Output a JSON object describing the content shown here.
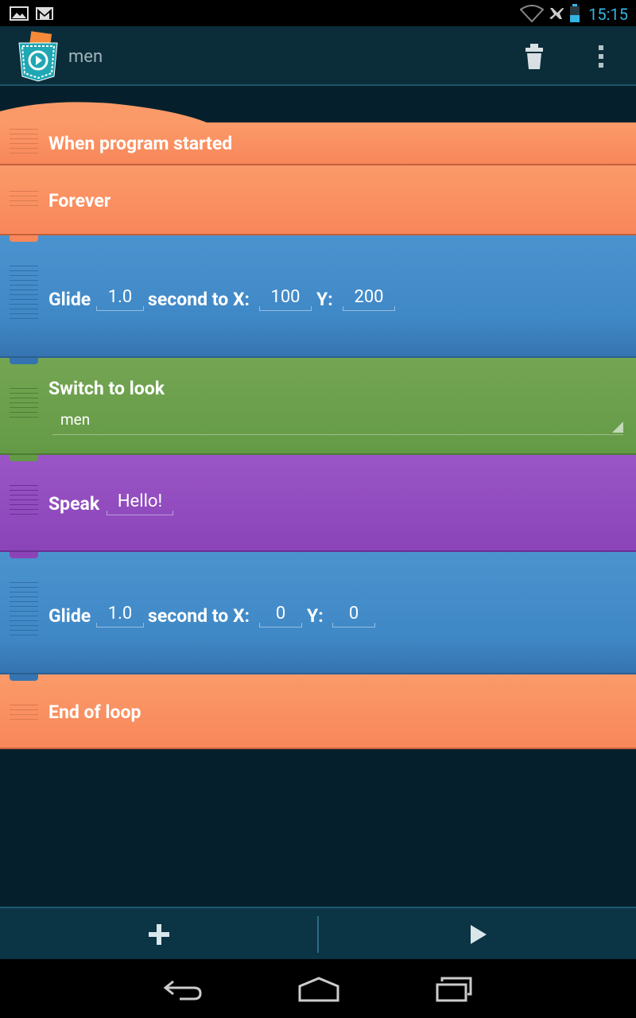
{
  "status_bar": {
    "time": "15:15",
    "icons": [
      "gallery-icon",
      "gmail-icon",
      "wifi-icon",
      "airplane-icon",
      "battery-icon"
    ]
  },
  "action_bar": {
    "title": "men",
    "icons": [
      "app-logo-icon",
      "trash-icon",
      "overflow-menu-icon"
    ]
  },
  "bricks": {
    "when_started": {
      "label": "When program started"
    },
    "forever": {
      "label": "Forever"
    },
    "glide1": {
      "label": "Glide",
      "time": "1.0",
      "to_x_label": "second to X:",
      "x": "100",
      "y_label": "Y:",
      "y": "200"
    },
    "switch_look": {
      "label": "Switch to look",
      "look": "men"
    },
    "speak": {
      "label": "Speak",
      "text": "Hello!"
    },
    "glide2": {
      "label": "Glide",
      "time": "1.0",
      "to_x_label": "second to X:",
      "x": "0",
      "y_label": "Y:",
      "y": "0"
    },
    "end_loop": {
      "label": "End of loop"
    }
  },
  "bottom_bar": {
    "icons": [
      "add-icon",
      "play-icon"
    ]
  },
  "nav_bar": {
    "icons": [
      "back-icon",
      "home-icon",
      "recent-apps-icon"
    ]
  },
  "colors": {
    "control": "#f8875a",
    "motion": "#4089c7",
    "looks": "#6a9e4b",
    "sound": "#8f49bf",
    "accent": "#33b5e5"
  }
}
